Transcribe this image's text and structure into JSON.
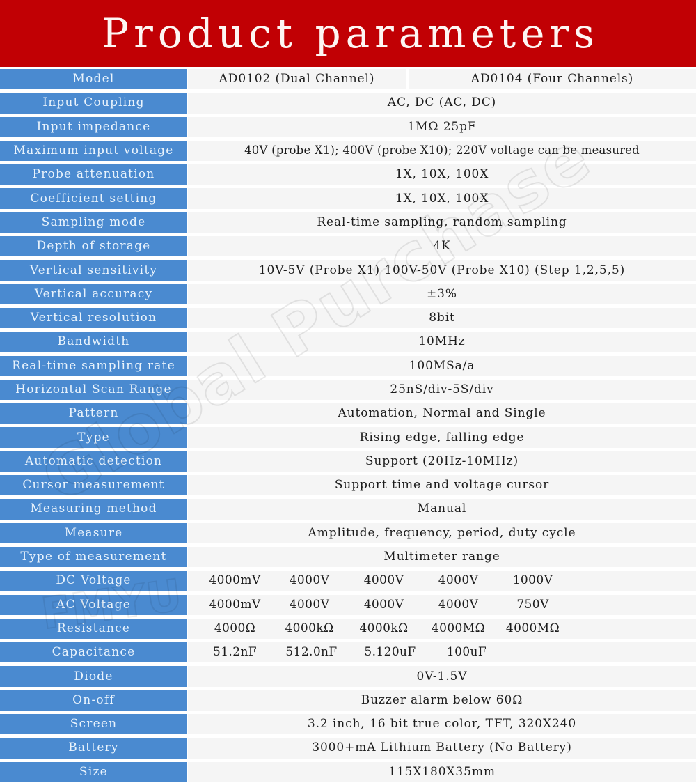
{
  "banner": {
    "title": "Product parameters",
    "background_color": "#c10004",
    "text_color": "#fdf6f3"
  },
  "theme": {
    "label_background": "#4a8ad0",
    "label_text": "#e9f3fc",
    "value_background": "#f5f5f5",
    "value_text": "#1c1c1c",
    "page_background": "#ffffff"
  },
  "watermark": {
    "main": "Global Purchase",
    "secondary": "FMYU"
  },
  "table": {
    "rows": [
      {
        "label": "Model",
        "type": "split",
        "value_a": "AD0102 (Dual Channel)",
        "value_b": "AD0104 (Four Channels)"
      },
      {
        "label": "Input Coupling",
        "type": "single",
        "value": "AC, DC (AC, DC)"
      },
      {
        "label": "Input impedance",
        "type": "single",
        "value": "1MΩ 25pF"
      },
      {
        "label": "Maximum input voltage",
        "type": "single",
        "tight": true,
        "value": "40V (probe X1); 400V (probe X10); 220V voltage can be measured"
      },
      {
        "label": "Probe attenuation",
        "type": "single",
        "value": "1X, 10X, 100X"
      },
      {
        "label": "Coefficient setting",
        "type": "single",
        "value": "1X, 10X, 100X"
      },
      {
        "label": "Sampling mode",
        "type": "single",
        "value": "Real-time sampling, random sampling"
      },
      {
        "label": "Depth of storage",
        "type": "single",
        "value": "4K"
      },
      {
        "label": "Vertical sensitivity",
        "type": "single",
        "value": "10V-5V (Probe X1) 100V-50V (Probe X10) (Step 1,2,5,5)"
      },
      {
        "label": "Vertical accuracy",
        "type": "single",
        "value": "±3%"
      },
      {
        "label": "Vertical resolution",
        "type": "single",
        "value": "8bit"
      },
      {
        "label": "Bandwidth",
        "type": "single",
        "value": "10MHz"
      },
      {
        "label": "Real-time sampling rate",
        "type": "single",
        "value": "100MSa/a"
      },
      {
        "label": "Horizontal Scan Range",
        "type": "single",
        "value": "25nS/div-5S/div"
      },
      {
        "label": "Pattern",
        "type": "single",
        "value": "Automation, Normal and Single"
      },
      {
        "label": "Type",
        "type": "single",
        "value": "Rising edge, falling edge"
      },
      {
        "label": "Automatic detection",
        "type": "single",
        "value": "Support (20Hz-10MHz)"
      },
      {
        "label": "Cursor measurement",
        "type": "single",
        "value": "Support time and voltage cursor"
      },
      {
        "label": "Measuring method",
        "type": "single",
        "value": "Manual"
      },
      {
        "label": "Measure",
        "type": "single",
        "value": "Amplitude, frequency, period, duty cycle"
      },
      {
        "label": "Type of measurement",
        "type": "single",
        "value": "Multimeter range"
      },
      {
        "label": "DC Voltage",
        "type": "columns",
        "values": [
          "4000mV",
          "4000V",
          "4000V",
          "4000V",
          "1000V"
        ]
      },
      {
        "label": "AC Voltage",
        "type": "columns",
        "values": [
          "4000mV",
          "4000V",
          "4000V",
          "4000V",
          "750V"
        ]
      },
      {
        "label": "Resistance",
        "type": "columns",
        "values": [
          "4000Ω",
          "4000kΩ",
          "4000kΩ",
          "4000MΩ",
          "4000MΩ"
        ]
      },
      {
        "label": "Capacitance",
        "type": "columns",
        "values": [
          "51.2nF",
          "512.0nF",
          "5.120uF",
          "100uF"
        ]
      },
      {
        "label": "Diode",
        "type": "single",
        "value": "0V-1.5V"
      },
      {
        "label": "On-off",
        "type": "single",
        "value": "Buzzer alarm below 60Ω"
      },
      {
        "label": "Screen",
        "type": "single",
        "value": "3.2 inch, 16 bit true color, TFT, 320X240"
      },
      {
        "label": "Battery",
        "type": "single",
        "value": "3000+mA Lithium Battery (No Battery)"
      },
      {
        "label": "Size",
        "type": "single",
        "value": "115X180X35mm"
      }
    ]
  }
}
